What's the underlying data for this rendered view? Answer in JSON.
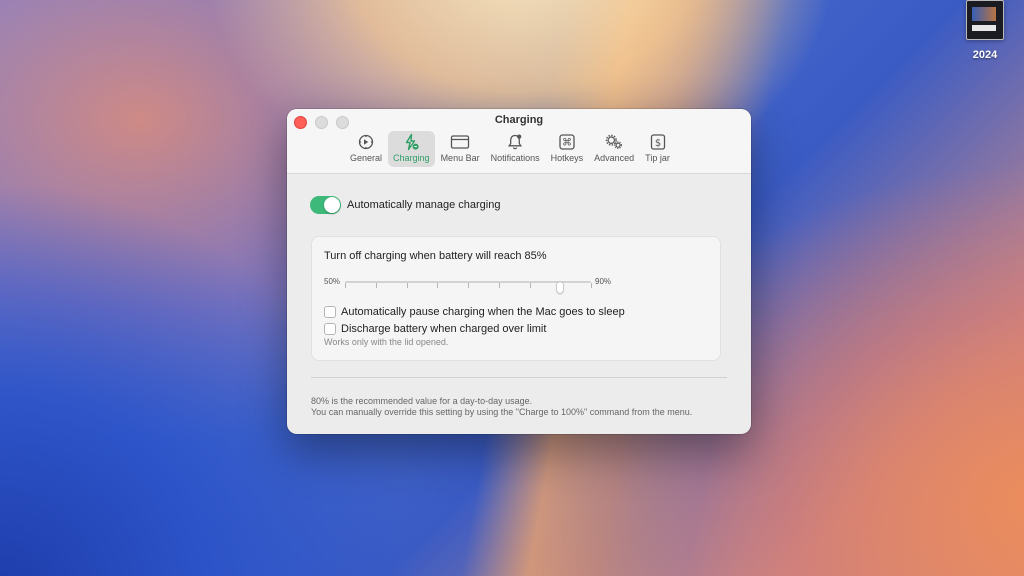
{
  "desktop": {
    "item_label": "2024"
  },
  "window": {
    "title": "Charging"
  },
  "tabs": [
    {
      "label": "General",
      "icon": "dial-icon",
      "active": false
    },
    {
      "label": "Charging",
      "icon": "bolt-icon",
      "active": true
    },
    {
      "label": "Menu Bar",
      "icon": "window-icon",
      "active": false
    },
    {
      "label": "Notifications",
      "icon": "bell-icon",
      "active": false
    },
    {
      "label": "Hotkeys",
      "icon": "command-key-icon",
      "active": false
    },
    {
      "label": "Advanced",
      "icon": "gears-icon",
      "active": false
    },
    {
      "label": "Tip jar",
      "icon": "dollar-icon",
      "active": false
    }
  ],
  "auto_manage": {
    "label": "Automatically manage charging",
    "enabled": true
  },
  "limit": {
    "title": "Turn off charging when battery will reach 85%",
    "min_label": "50%",
    "max_label": "90%",
    "min": 50,
    "max": 90,
    "value": 85,
    "ticks": 9
  },
  "options": {
    "pause_sleep": {
      "label": "Automatically pause charging when the Mac goes to sleep",
      "checked": false
    },
    "discharge": {
      "label": "Discharge battery when charged over limit",
      "checked": false
    },
    "hint": "Works only with the lid opened."
  },
  "footer": {
    "line1": "80% is the recommended value for a day-to-day usage.",
    "line2": "You can manually override this setting by using the \"Charge to 100%\" command from the menu."
  },
  "colors": {
    "accent": "#3dba7a",
    "close": "#fe5f57"
  }
}
